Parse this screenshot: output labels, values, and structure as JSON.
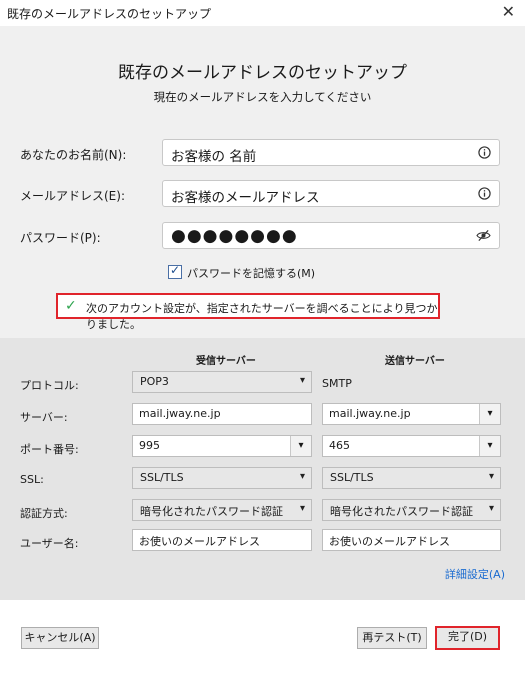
{
  "window": {
    "title": "既存のメールアドレスのセットアップ"
  },
  "header": {
    "title": "既存のメールアドレスのセットアップ",
    "subtitle": "現在のメールアドレスを入力してください"
  },
  "form": {
    "name_label": "あなたのお名前(N):",
    "name_value": "お客様の 名前",
    "email_label": "メールアドレス(E):",
    "email_value": "お客様のメールアドレス",
    "password_label": "パスワード(P):",
    "password_mask": "●●●●●●●●",
    "remember_label": "パスワードを記憶する(M)",
    "remember_checked": "✓"
  },
  "notice": {
    "icon": "✓",
    "message": "次のアカウント設定が、指定されたサーバーを調べることにより見つかりました。"
  },
  "server_settings": {
    "incoming_header": "受信サーバー",
    "outgoing_header": "送信サーバー",
    "rows": {
      "protocol": {
        "label": "プロトコル:",
        "incoming": "POP3",
        "outgoing": "SMTP"
      },
      "server": {
        "label": "サーバー:",
        "incoming": "mail.jway.ne.jp",
        "outgoing": "mail.jway.ne.jp"
      },
      "port": {
        "label": "ポート番号:",
        "incoming": "995",
        "outgoing": "465"
      },
      "ssl": {
        "label": "SSL:",
        "incoming": "SSL/TLS",
        "outgoing": "SSL/TLS"
      },
      "auth": {
        "label": "認証方式:",
        "incoming": "暗号化されたパスワード認証",
        "outgoing": "暗号化されたパスワード認証"
      },
      "username": {
        "label": "ユーザー名:",
        "incoming": "お使いのメールアドレス",
        "outgoing": "お使いのメールアドレス"
      }
    },
    "advanced_link": "詳細設定(A)"
  },
  "buttons": {
    "cancel": "キャンセル(A)",
    "retest": "再テスト(T)",
    "done": "完了(D)"
  },
  "icons": {
    "close": "✕",
    "dropdown": "▾"
  },
  "colors": {
    "highlight_border": "#e0242b",
    "success_check": "#2da44e",
    "link": "#1a6bd0"
  }
}
